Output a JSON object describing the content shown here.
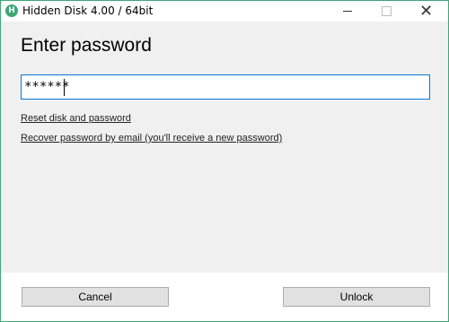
{
  "window": {
    "title": "Hidden Disk 4.00 / 64bit",
    "app_icon_glyph": "H"
  },
  "titlebar_buttons": {
    "minimize": "minimize-icon",
    "maximize": "maximize-icon",
    "close": "close-icon",
    "close_glyph": "✕"
  },
  "dialog": {
    "heading": "Enter password",
    "password_mask": "******",
    "reset_link": "Reset disk and password",
    "recover_link": "Recover password by email (you'll receive a new password)"
  },
  "buttons": {
    "cancel": "Cancel",
    "unlock": "Unlock"
  },
  "colors": {
    "accent": "#3fa776",
    "input_focus_border": "#0078d7"
  }
}
